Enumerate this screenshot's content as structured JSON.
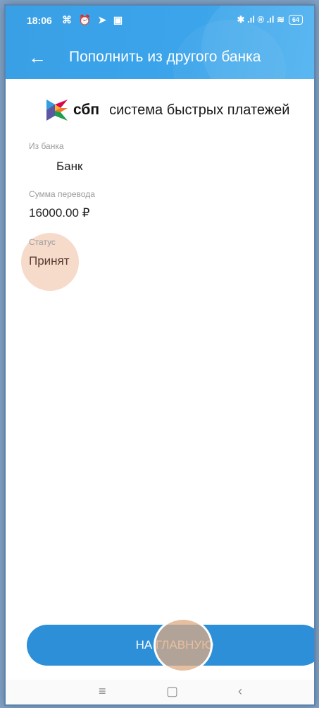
{
  "status_bar": {
    "time": "18:06",
    "left_icons": "⌘ ⏰ ➤ ▣",
    "right_icons": "✱ .ıl ® .ıl ≋",
    "battery": "64"
  },
  "header": {
    "back_icon": "←",
    "title": "Пополнить из другого банка"
  },
  "sbp": {
    "abbr": "сбп",
    "full_name": "система быстрых платежей"
  },
  "details": {
    "from_bank": {
      "label": "Из банка",
      "value": "Банк"
    },
    "amount": {
      "label": "Сумма перевода",
      "value": "16000.00 ₽"
    },
    "status": {
      "label": "Статус",
      "value": "Принят"
    }
  },
  "button": {
    "label": "НА ГЛАВНУЮ"
  },
  "nav": {
    "menu": "≡",
    "home": "▢",
    "back": "‹"
  },
  "colors": {
    "header": "#3ba4ea",
    "button": "#2c8fd8",
    "highlight": "#ecb08c"
  }
}
